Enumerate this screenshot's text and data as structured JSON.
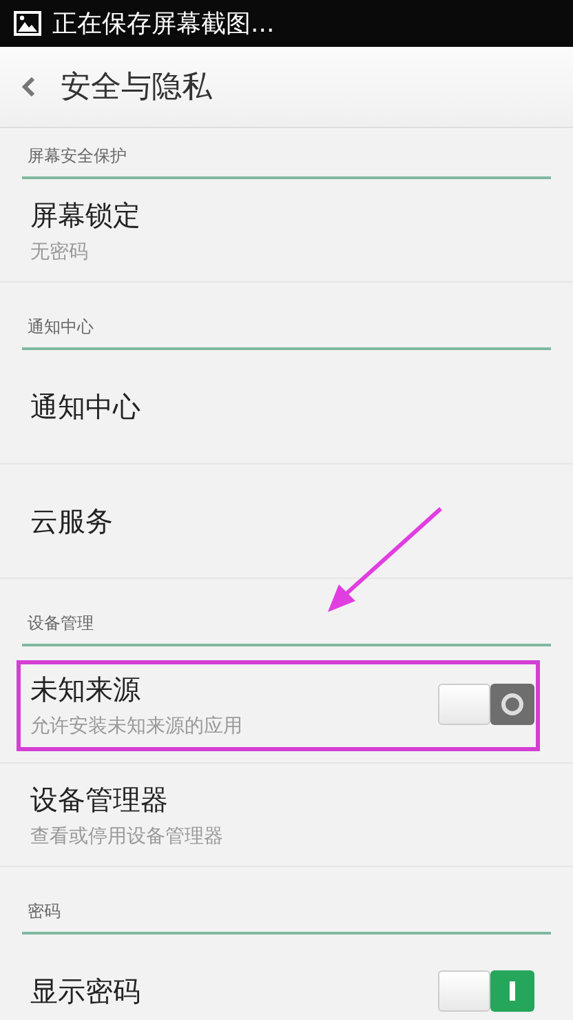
{
  "status_bar": {
    "notification": "正在保存屏幕截图..."
  },
  "header": {
    "title": "安全与隐私"
  },
  "sections": [
    {
      "header": "屏幕安全保护",
      "items": [
        {
          "kind": "text",
          "title": "屏幕锁定",
          "subtitle": "无密码",
          "highlighted": false
        }
      ]
    },
    {
      "header": "通知中心",
      "items": [
        {
          "kind": "text",
          "title": "通知中心",
          "highlighted": false
        },
        {
          "kind": "text",
          "title": "云服务",
          "highlighted": false
        }
      ]
    },
    {
      "header": "设备管理",
      "items": [
        {
          "kind": "toggle",
          "title": "未知来源",
          "subtitle": "允许安装未知来源的应用",
          "on": false,
          "highlighted": true
        },
        {
          "kind": "text",
          "title": "设备管理器",
          "subtitle": "查看或停用设备管理器",
          "highlighted": false
        }
      ]
    },
    {
      "header": "密码",
      "items": [
        {
          "kind": "toggle",
          "title": "显示密码",
          "on": true,
          "highlighted": false
        }
      ]
    }
  ]
}
